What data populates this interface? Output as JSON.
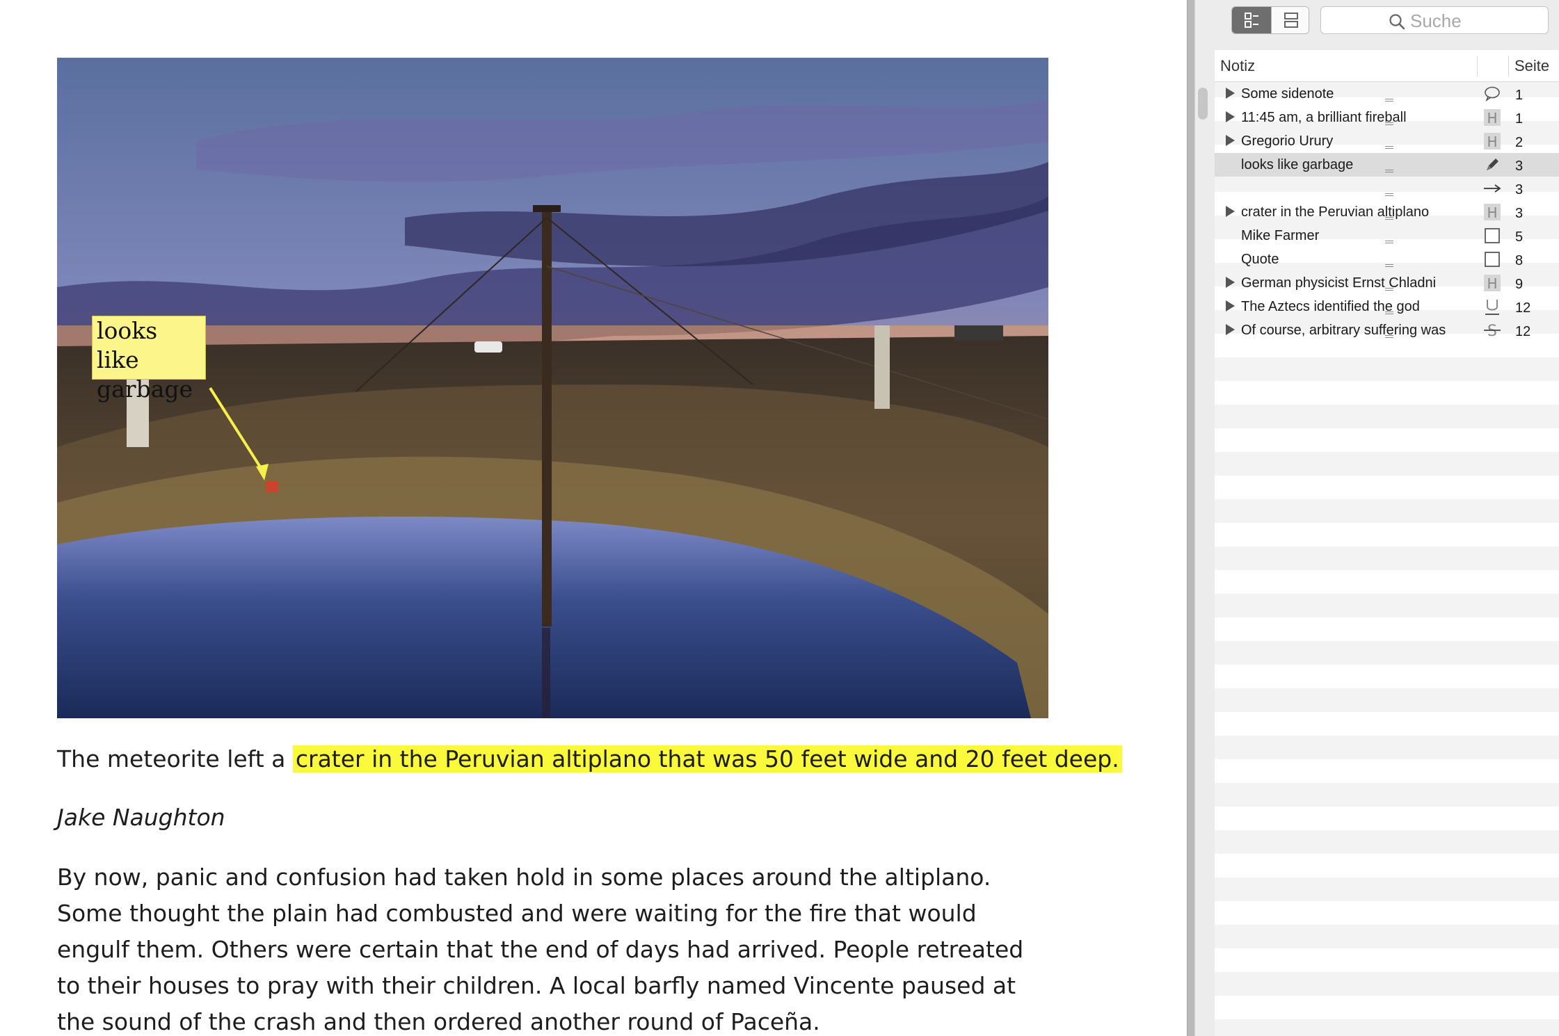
{
  "document": {
    "photo_annotation": "looks like\ngarbage",
    "paragraph1_prefix": "The meteorite left a ",
    "paragraph1_highlight": "crater in the Peruvian altiplano that was 50 feet wide and 20 feet deep.",
    "byline": "Jake Naughton",
    "paragraph2": "By now, panic and confusion had taken hold in some places around the altiplano. Some thought the plain had combusted and were waiting for the fire that would engulf them. Others were certain that the end of days had arrived. People retreated to their houses to pray with their children. A local barfly named Vincente paused at the sound of the crash and then ordered another round of Paceña."
  },
  "sidebar": {
    "search_placeholder": "Suche",
    "columns": {
      "note": "Notiz",
      "page": "Seite"
    },
    "rows": [
      {
        "label": "Some sidenote",
        "type": "comment-icon",
        "page": "1",
        "expandable": true
      },
      {
        "label": "11:45 am, a brilliant fireball",
        "type": "highlight-icon",
        "page": "1",
        "expandable": true
      },
      {
        "label": "Gregorio Urury",
        "type": "highlight-icon",
        "page": "2",
        "expandable": true
      },
      {
        "label": "looks like garbage",
        "type": "pencil-icon",
        "page": "3",
        "expandable": false,
        "selected": true
      },
      {
        "label": "",
        "type": "arrow-icon",
        "page": "3",
        "expandable": false
      },
      {
        "label": "crater in the Peruvian altiplano",
        "type": "highlight-icon",
        "page": "3",
        "expandable": true
      },
      {
        "label": "Mike Farmer",
        "type": "box-icon",
        "page": "5",
        "expandable": false
      },
      {
        "label": "Quote",
        "type": "box-icon",
        "page": "8",
        "expandable": false
      },
      {
        "label": "German physicist Ernst Chladni",
        "type": "highlight-icon",
        "page": "9",
        "expandable": true
      },
      {
        "label": "The Aztecs identified the god",
        "type": "underline-icon",
        "page": "12",
        "expandable": true
      },
      {
        "label": "Of course, arbitrary suffering was",
        "type": "strikethrough-icon",
        "page": "12",
        "expandable": true
      }
    ]
  },
  "colors": {
    "highlight": "#fbf93b",
    "note_bg": "#fbf58a",
    "sidebar_bg": "#ececec",
    "selected_row": "#dcdcdc"
  }
}
